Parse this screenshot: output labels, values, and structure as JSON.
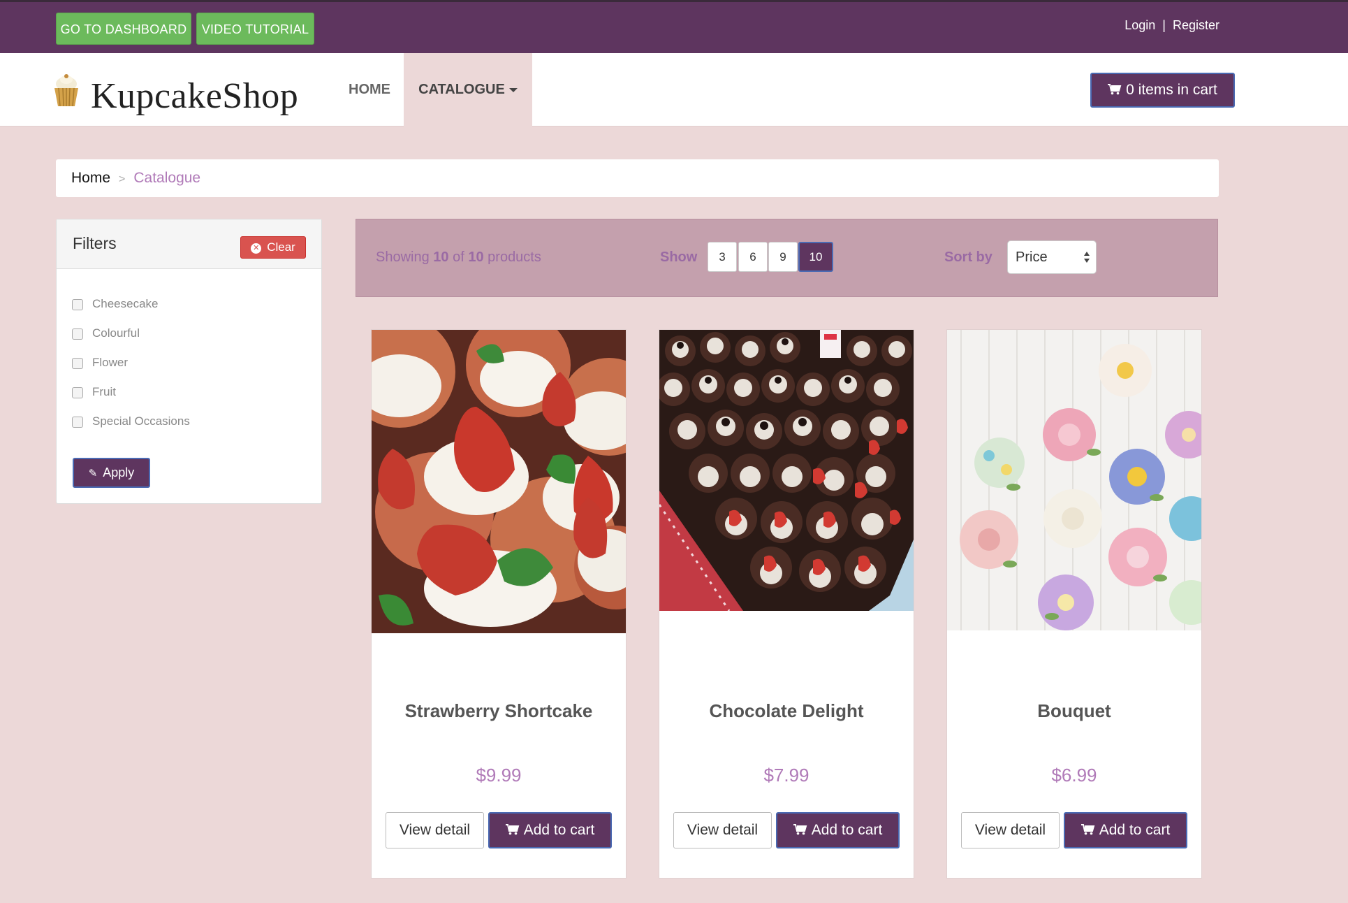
{
  "topbar": {
    "dashboard_label": "GO TO DASHBOARD",
    "tutorial_label": "VIDEO TUTORIAL",
    "login_label": "Login",
    "separator": "|",
    "register_label": "Register"
  },
  "header": {
    "logo_text": "KupcakeShop",
    "nav": {
      "home": "HOME",
      "catalogue": "CATALOGUE"
    },
    "cart_label": "0 items in cart"
  },
  "breadcrumb": {
    "home": "Home",
    "separator": ">",
    "current": "Catalogue"
  },
  "filters": {
    "title": "Filters",
    "clear_label": "Clear",
    "items": [
      {
        "label": "Cheesecake"
      },
      {
        "label": "Colourful"
      },
      {
        "label": "Flower"
      },
      {
        "label": "Fruit"
      },
      {
        "label": "Special Occasions"
      }
    ],
    "apply_label": "Apply"
  },
  "toolbar": {
    "showing_prefix": "Showing",
    "showing_count": "10",
    "showing_of": "of",
    "showing_total": "10",
    "showing_suffix": "products",
    "show_label": "Show",
    "page_sizes": [
      "3",
      "6",
      "9",
      "10"
    ],
    "selected_page_size": "10",
    "sort_label": "Sort by",
    "sort_value": "Price"
  },
  "products": [
    {
      "name": "Strawberry Shortcake",
      "price": "$9.99",
      "view_label": "View detail",
      "cart_label": "Add to cart"
    },
    {
      "name": "Chocolate Delight",
      "price": "$7.99",
      "view_label": "View detail",
      "cart_label": "Add to cart"
    },
    {
      "name": "Bouquet",
      "price": "$6.99",
      "view_label": "View detail",
      "cart_label": "Add to cart"
    }
  ],
  "colors": {
    "brand_purple": "#5e355f",
    "green_button": "#6cba5c",
    "clear_red": "#d9534f",
    "page_background": "#ecd8d8",
    "accent_text": "#b07ab8"
  },
  "icons": {
    "cart": "shopping-cart-icon",
    "clear": "close-circle-icon",
    "apply": "pencil-icon",
    "logo": "cupcake-icon"
  }
}
